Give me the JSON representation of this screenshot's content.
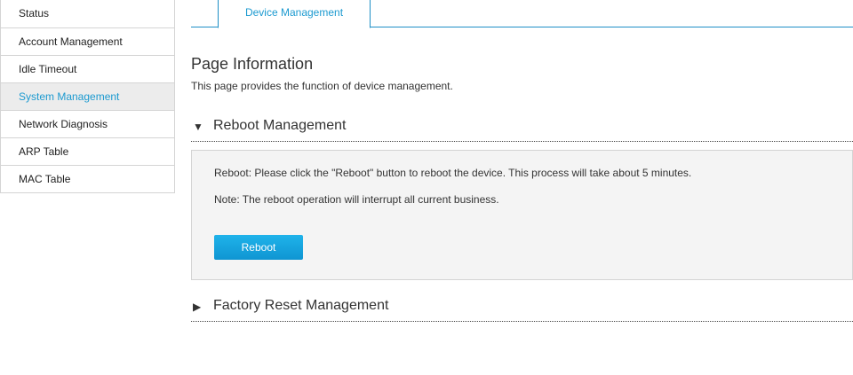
{
  "sidebar": {
    "items": [
      {
        "label": "Status"
      },
      {
        "label": "Account Management"
      },
      {
        "label": "Idle Timeout"
      },
      {
        "label": "System Management",
        "active": true
      },
      {
        "label": "Network Diagnosis"
      },
      {
        "label": "ARP Table"
      },
      {
        "label": "MAC Table"
      }
    ]
  },
  "tabs": [
    {
      "label": "Device Management",
      "active": true
    }
  ],
  "page": {
    "title": "Page Information",
    "description": "This page provides the function of device management."
  },
  "reboot": {
    "section_title": "Reboot Management",
    "expanded_icon": "triangle-down-icon",
    "line1": "Reboot: Please click the \"Reboot\" button to reboot the device. This process will take about 5 minutes.",
    "line2": "Note: The reboot operation will interrupt all current business.",
    "button_label": "Reboot"
  },
  "factory": {
    "section_title": "Factory Reset Management",
    "collapsed_icon": "triangle-right-icon"
  },
  "colors": {
    "accent": "#1c9ad0",
    "tab_border": "#1e8fc6",
    "button_top": "#1fb3ea",
    "button_bottom": "#0f95d2",
    "panel_bg": "#f4f4f4",
    "active_item_bg": "#ececec"
  }
}
